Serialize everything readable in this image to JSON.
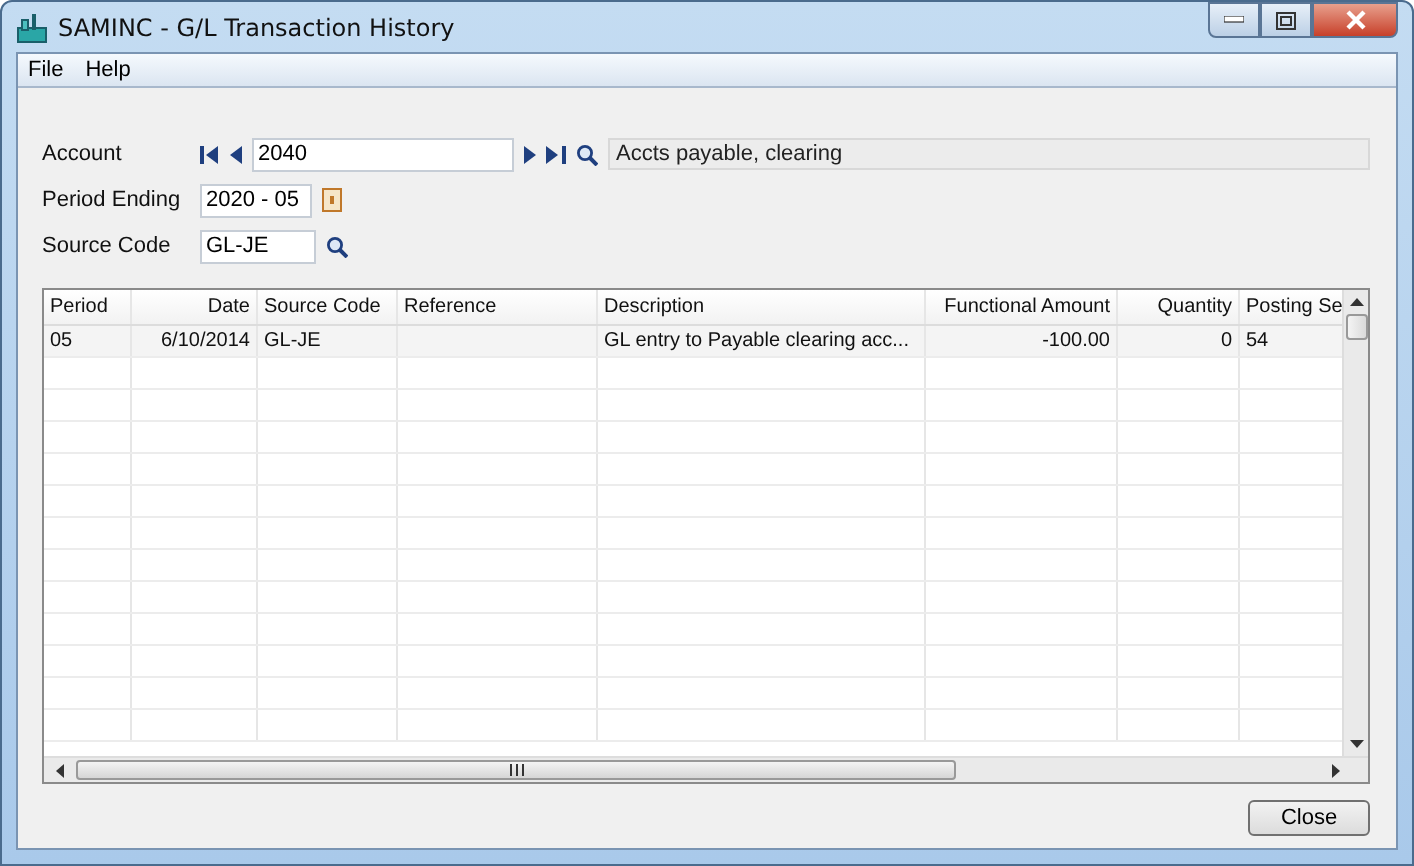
{
  "window": {
    "title": "SAMINC - G/L Transaction History"
  },
  "menu": [
    {
      "label": "File"
    },
    {
      "label": "Help"
    }
  ],
  "form": {
    "account": {
      "label": "Account",
      "value": "2040",
      "description": "Accts payable, clearing"
    },
    "period_ending": {
      "label": "Period Ending",
      "value": "2020 - 05"
    },
    "source_code": {
      "label": "Source Code",
      "value": "GL-JE"
    }
  },
  "table": {
    "columns": [
      {
        "label": "Period"
      },
      {
        "label": "Date"
      },
      {
        "label": "Source Code"
      },
      {
        "label": "Reference"
      },
      {
        "label": "Description"
      },
      {
        "label": "Functional Amount"
      },
      {
        "label": "Quantity"
      },
      {
        "label": "Posting Se"
      }
    ],
    "rows": [
      [
        "05",
        "6/10/2014",
        "GL-JE",
        "",
        "GL entry to Payable clearing acc...",
        "-100.00",
        "0",
        "54"
      ]
    ]
  },
  "buttons": [
    {
      "label": "Close"
    }
  ]
}
